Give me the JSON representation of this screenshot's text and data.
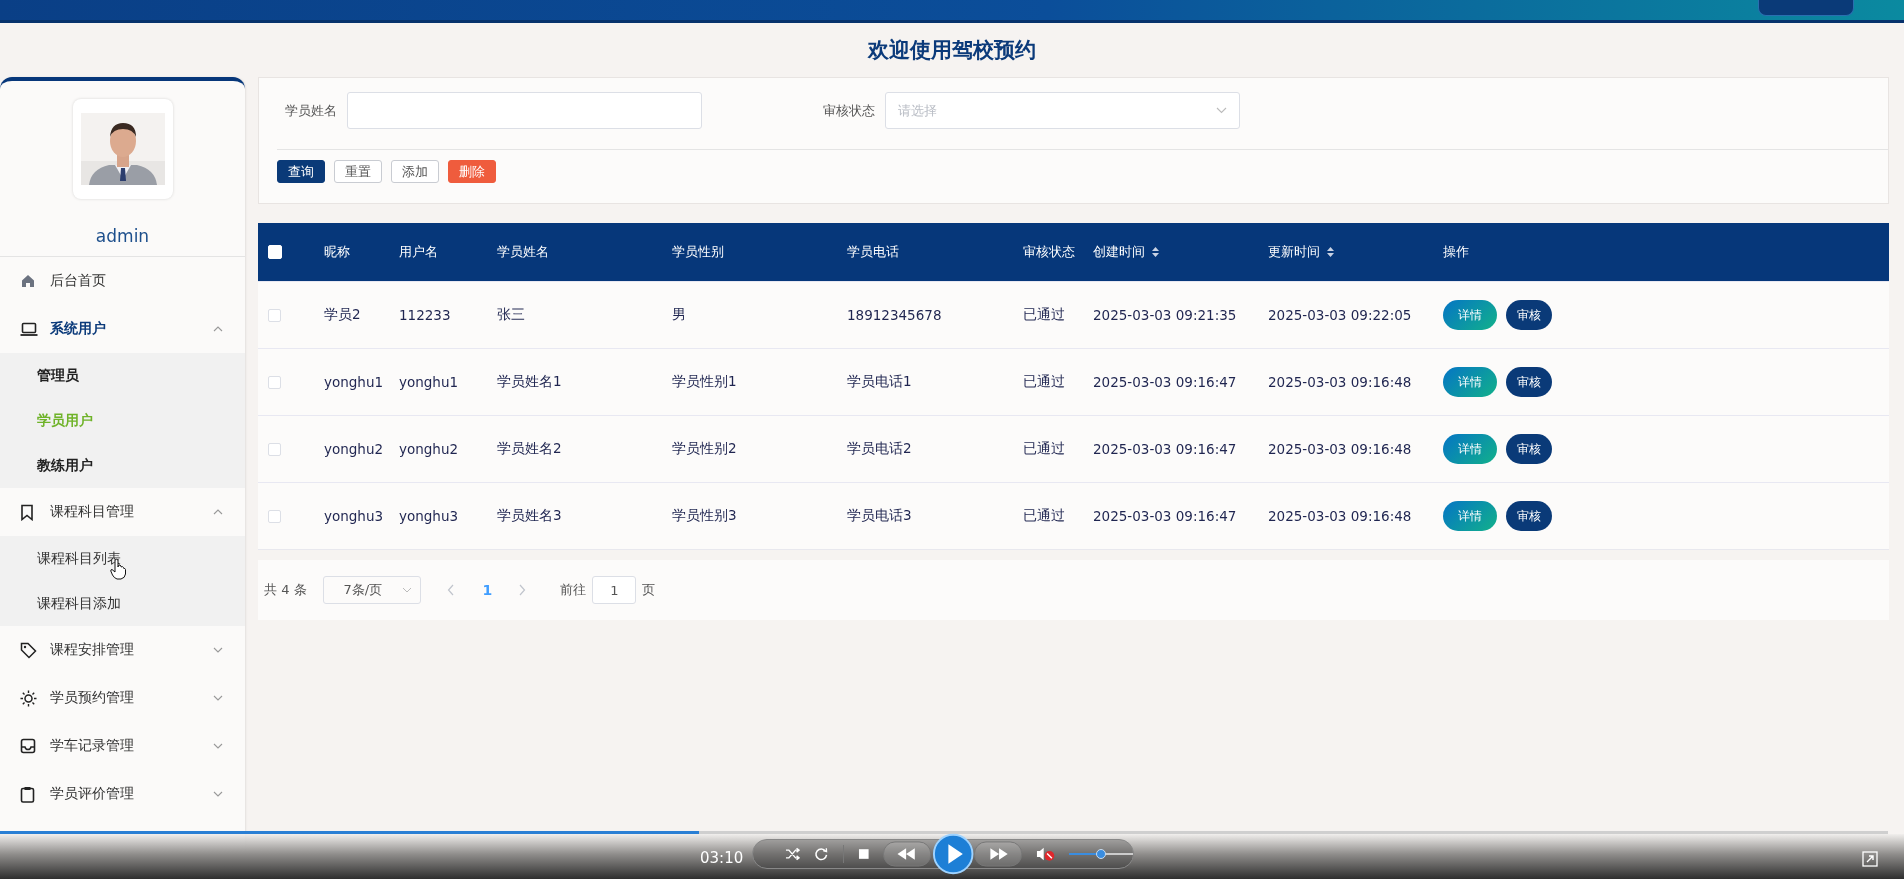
{
  "page_title": "欢迎使用驾校预约",
  "sidebar": {
    "user": "admin",
    "menu": [
      {
        "label": "后台首页",
        "kind": "link"
      },
      {
        "label": "系统用户",
        "kind": "group",
        "expanded": true,
        "children": [
          {
            "label": "管理员",
            "selected": false
          },
          {
            "label": "学员用户",
            "selected": true
          },
          {
            "label": "教练用户",
            "selected": false
          }
        ]
      },
      {
        "label": "课程科目管理",
        "kind": "group",
        "expanded": true,
        "children": [
          {
            "label": "课程科目列表",
            "selected": false
          },
          {
            "label": "课程科目添加",
            "selected": false
          }
        ]
      },
      {
        "label": "课程安排管理",
        "kind": "group",
        "expanded": false
      },
      {
        "label": "学员预约管理",
        "kind": "group",
        "expanded": false
      },
      {
        "label": "学车记录管理",
        "kind": "group",
        "expanded": false
      },
      {
        "label": "学员评价管理",
        "kind": "group",
        "expanded": false
      }
    ]
  },
  "filter": {
    "fields": [
      {
        "label": "学员姓名",
        "kind": "text"
      },
      {
        "label": "审核状态",
        "kind": "select",
        "placeholder": "请选择"
      }
    ],
    "buttons": [
      {
        "label": "查询",
        "kind": "primary"
      },
      {
        "label": "重置",
        "kind": "default"
      },
      {
        "label": "添加",
        "kind": "default"
      },
      {
        "label": "删除",
        "kind": "danger"
      }
    ]
  },
  "table": {
    "select_all": {
      "checked": false
    },
    "columns": [
      {
        "label": "昵称",
        "sortable": false
      },
      {
        "label": "用户名",
        "sortable": false
      },
      {
        "label": "学员姓名",
        "sortable": false
      },
      {
        "label": "学员性别",
        "sortable": false
      },
      {
        "label": "学员电话",
        "sortable": false
      },
      {
        "label": "审核状态",
        "sortable": false
      },
      {
        "label": "创建时间",
        "sortable": true
      },
      {
        "label": "更新时间",
        "sortable": true
      },
      {
        "label": "操作",
        "sortable": false
      }
    ],
    "rows": [
      {
        "checked": false,
        "cells": [
          "学员2",
          "112233",
          "张三",
          "男",
          "18912345678",
          "已通过",
          "2025-03-03 09:21:35",
          "2025-03-03 09:22:05"
        ],
        "actions": [
          "详情",
          "审核"
        ]
      },
      {
        "checked": false,
        "cells": [
          "yonghu1",
          "yonghu1",
          "学员姓名1",
          "学员性别1",
          "学员电话1",
          "已通过",
          "2025-03-03 09:16:47",
          "2025-03-03 09:16:48"
        ],
        "actions": [
          "详情",
          "审核"
        ]
      },
      {
        "checked": false,
        "cells": [
          "yonghu2",
          "yonghu2",
          "学员姓名2",
          "学员性别2",
          "学员电话2",
          "已通过",
          "2025-03-03 09:16:47",
          "2025-03-03 09:16:48"
        ],
        "actions": [
          "详情",
          "审核"
        ]
      },
      {
        "checked": false,
        "cells": [
          "yonghu3",
          "yonghu3",
          "学员姓名3",
          "学员性别3",
          "学员电话3",
          "已通过",
          "2025-03-03 09:16:47",
          "2025-03-03 09:16:48"
        ],
        "actions": [
          "详情",
          "审核"
        ]
      }
    ]
  },
  "pagination": {
    "total": "共 4 条",
    "page_size": "7条/页",
    "pages": [
      {
        "label": "1",
        "selected": true
      }
    ],
    "goto_label": "前往",
    "goto_value": "1",
    "goto_suffix": "页"
  },
  "player": {
    "time": "03:10",
    "level": 0.37,
    "muted": true,
    "volume": {
      "level": 0.5
    }
  }
}
